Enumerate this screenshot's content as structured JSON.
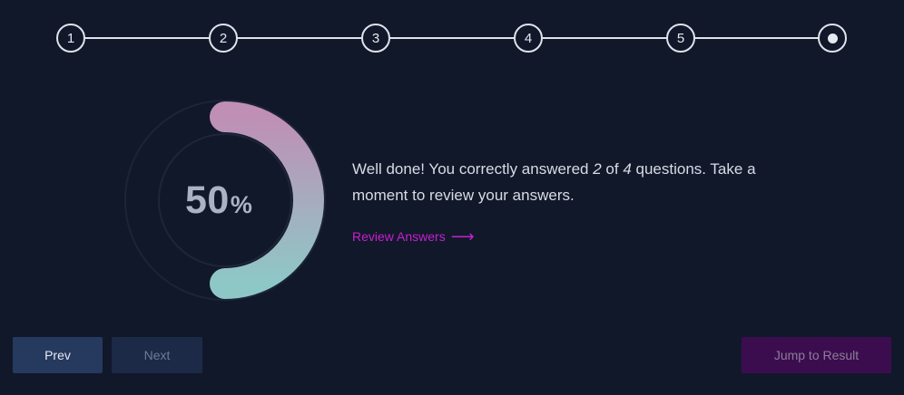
{
  "stepper": {
    "steps": [
      "1",
      "2",
      "3",
      "4",
      "5"
    ],
    "final_icon": "filled-dot-icon"
  },
  "result": {
    "score_value": "50",
    "score_unit": "%",
    "progress_fraction": 0.5,
    "message_part1": "Well done! You correctly answered ",
    "correct": "2",
    "message_part2": " of ",
    "total": "4",
    "message_part3": " questions. Take a moment to review your answers.",
    "review_label": "Review Answers",
    "review_arrow": "⟶"
  },
  "buttons": {
    "prev": "Prev",
    "next": "Next",
    "jump": "Jump to Result"
  },
  "colors": {
    "background": "#11182a",
    "gauge_start": "#bf8fb6",
    "gauge_end": "#8ec8c6",
    "link": "#c81fd0"
  }
}
